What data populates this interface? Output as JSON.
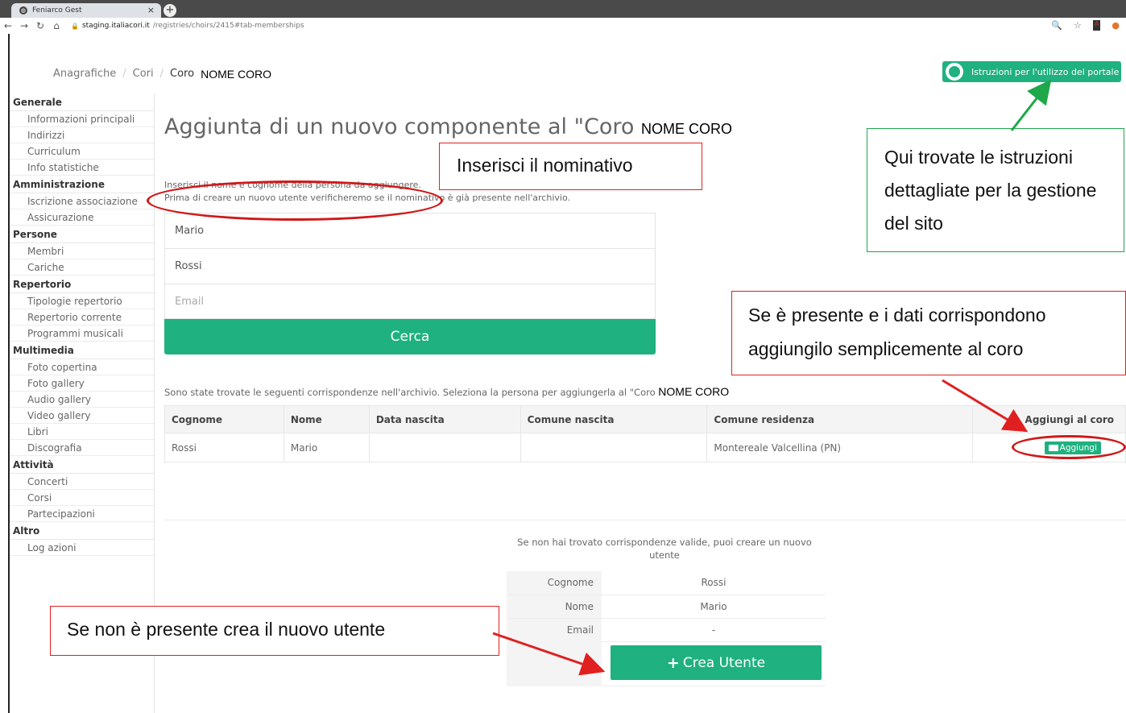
{
  "browser": {
    "tab_title": "Feniarco Gest",
    "tab_close": "×",
    "new_tab": "+",
    "url_host": "staging.italiacori.it",
    "url_path": "/registries/choirs/2415#tab-memberships"
  },
  "breadcrumb": {
    "item1": "Anagrafiche",
    "sep": "/",
    "item2": "Cori",
    "current": "Coro",
    "annot": "NOME CORO"
  },
  "help_button": {
    "label": "Istruzioni per l'utilizzo del portale"
  },
  "sidebar": {
    "sections": [
      {
        "title": "Generale",
        "items": [
          "Informazioni principali",
          "Indirizzi",
          "Curriculum",
          "Info statistiche"
        ]
      },
      {
        "title": "Amministrazione",
        "items": [
          "Iscrizione associazione",
          "Assicurazione"
        ]
      },
      {
        "title": "Persone",
        "items": [
          "Membri",
          "Cariche"
        ]
      },
      {
        "title": "Repertorio",
        "items": [
          "Tipologie repertorio",
          "Repertorio corrente",
          "Programmi musicali"
        ]
      },
      {
        "title": "Multimedia",
        "items": [
          "Foto copertina",
          "Foto gallery",
          "Audio gallery",
          "Video gallery",
          "Libri",
          "Discografia"
        ]
      },
      {
        "title": "Attività",
        "items": [
          "Concerti",
          "Corsi",
          "Partecipazioni"
        ]
      },
      {
        "title": "Altro",
        "items": [
          "Log azioni"
        ]
      }
    ]
  },
  "main": {
    "title": "Aggiunta di un nuovo componente al \"Coro",
    "title_annot": "NOME CORO",
    "intro_line1": "Inserisci il nome e cognome della persona da aggiungere.",
    "intro_line2": "Prima di creare un nuovo utente verificheremo se il nominativo è già presente nell'archivio.",
    "form": {
      "first_name": "Mario",
      "last_name": "Rossi",
      "email_placeholder": "Email",
      "search_label": "Cerca"
    },
    "found_text": "Sono state trovate le seguenti corrispondenze nell'archivio. Seleziona la persona per aggiungerla al \"Coro",
    "found_annot": "NOME CORO",
    "results": {
      "headers": [
        "Cognome",
        "Nome",
        "Data nascita",
        "Comune nascita",
        "Comune residenza",
        "Aggiungi al coro"
      ],
      "rows": [
        {
          "cognome": "Rossi",
          "nome": "Mario",
          "data_nascita": "",
          "comune_nascita": "",
          "comune_residenza": "Montereale Valcellina (PN)",
          "action": "Aggiungi"
        }
      ]
    },
    "no_match_text": "Se non hai trovato corrispondenze valide, puoi creare un nuovo utente",
    "new_user": {
      "cognome_label": "Cognome",
      "cognome_value": "Rossi",
      "nome_label": "Nome",
      "nome_value": "Mario",
      "email_label": "Email",
      "email_value": "-",
      "create_label": "Crea Utente"
    }
  },
  "annotations": {
    "nominativo": "Inserisci il nominativo",
    "istruzioni": "Qui trovate le istruzioni dettagliate per la gestione del sito",
    "presente": "Se è presente e i dati corrispondono aggiungilo semplicemente al coro",
    "non_presente": "Se non è presente crea il nuovo utente"
  }
}
